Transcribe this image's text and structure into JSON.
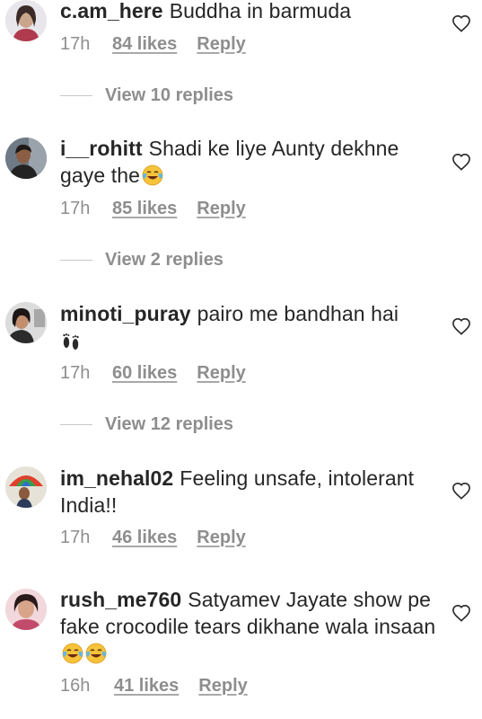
{
  "comments": [
    {
      "username": "c.am_here",
      "text": "Buddha in barmuda",
      "time": "17h",
      "likes": "84 likes",
      "reply": "Reply",
      "view_replies": "View 10 replies"
    },
    {
      "username": "i__rohitt",
      "text": "Shadi ke liye Aunty dekhne gaye the",
      "time": "17h",
      "likes": "85 likes",
      "reply": "Reply",
      "view_replies": "View 2 replies"
    },
    {
      "username": "minoti_puray",
      "text": "pairo me bandhan hai",
      "time": "17h",
      "likes": "60 likes",
      "reply": "Reply",
      "view_replies": "View 12 replies"
    },
    {
      "username": "im_nehal02",
      "text": "Feeling unsafe, intolerant India!!",
      "time": "17h",
      "likes": "46 likes",
      "reply": "Reply"
    },
    {
      "username": "rush_me760",
      "text": "Satyamev Jayate show pe fake crocodile tears dikhane wala insaan",
      "time": "16h",
      "likes": "41 likes",
      "reply": "Reply"
    }
  ],
  "icons": {
    "like": "heart-outline-icon",
    "laugh": "face-with-tears-of-joy-emoji",
    "feet": "footprints-emoji"
  },
  "colors": {
    "text": "#262626",
    "secondary": "#8e8e8e",
    "divider": "#c7c7c7"
  }
}
